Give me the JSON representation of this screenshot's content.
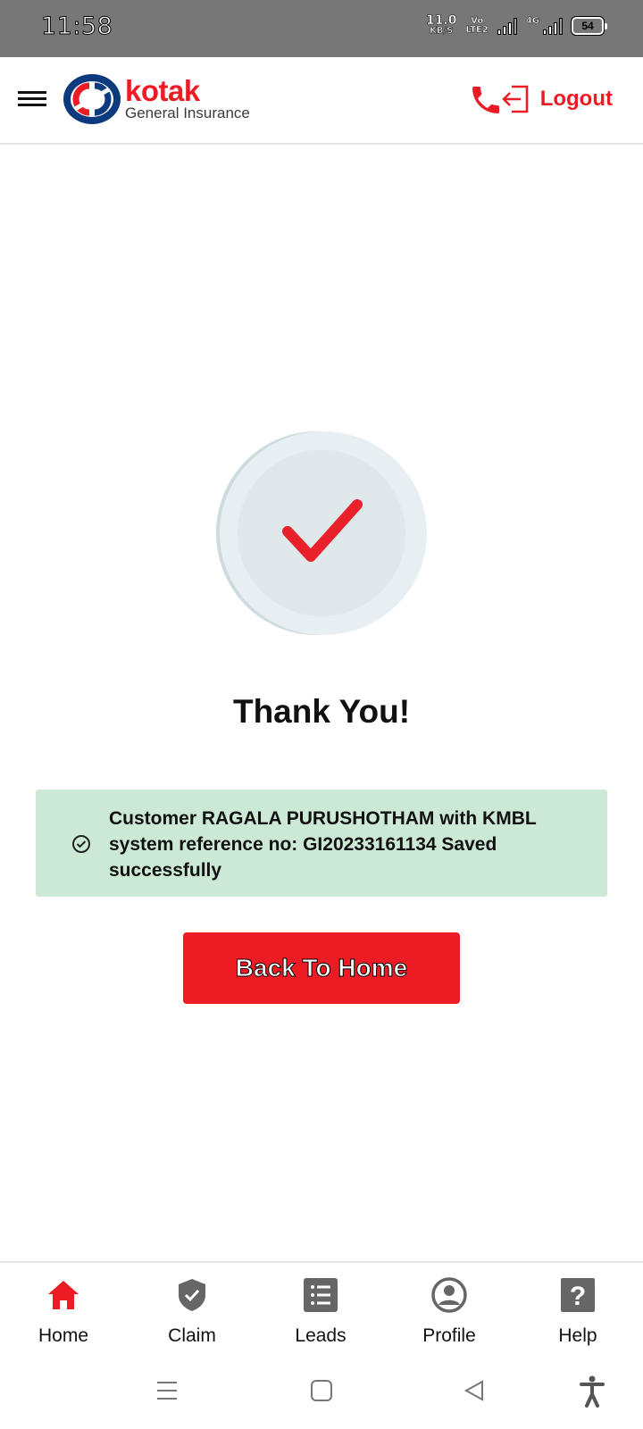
{
  "status_bar": {
    "time": "11:58",
    "net_speed_value": "11.0",
    "net_speed_unit": "KB/S",
    "volte_top": "Vo",
    "volte_bottom": "LTE2",
    "network_type": "4G",
    "battery": "54"
  },
  "header": {
    "brand": "kotak",
    "brand_sub": "General Insurance",
    "logout_label": "Logout",
    "accent_color": "#ed1c24"
  },
  "main": {
    "title": "Thank You!",
    "success_message": "Customer RAGALA  PURUSHOTHAM with KMBL system reference no: GI20233161134 Saved successfully",
    "back_button_label": "Back To Home"
  },
  "bottom_nav": {
    "items": [
      {
        "label": "Home",
        "icon": "home-icon",
        "active": true
      },
      {
        "label": "Claim",
        "icon": "shield-check-icon",
        "active": false
      },
      {
        "label": "Leads",
        "icon": "list-icon",
        "active": false
      },
      {
        "label": "Profile",
        "icon": "user-circle-icon",
        "active": false
      },
      {
        "label": "Help",
        "icon": "question-icon",
        "active": false
      }
    ]
  }
}
